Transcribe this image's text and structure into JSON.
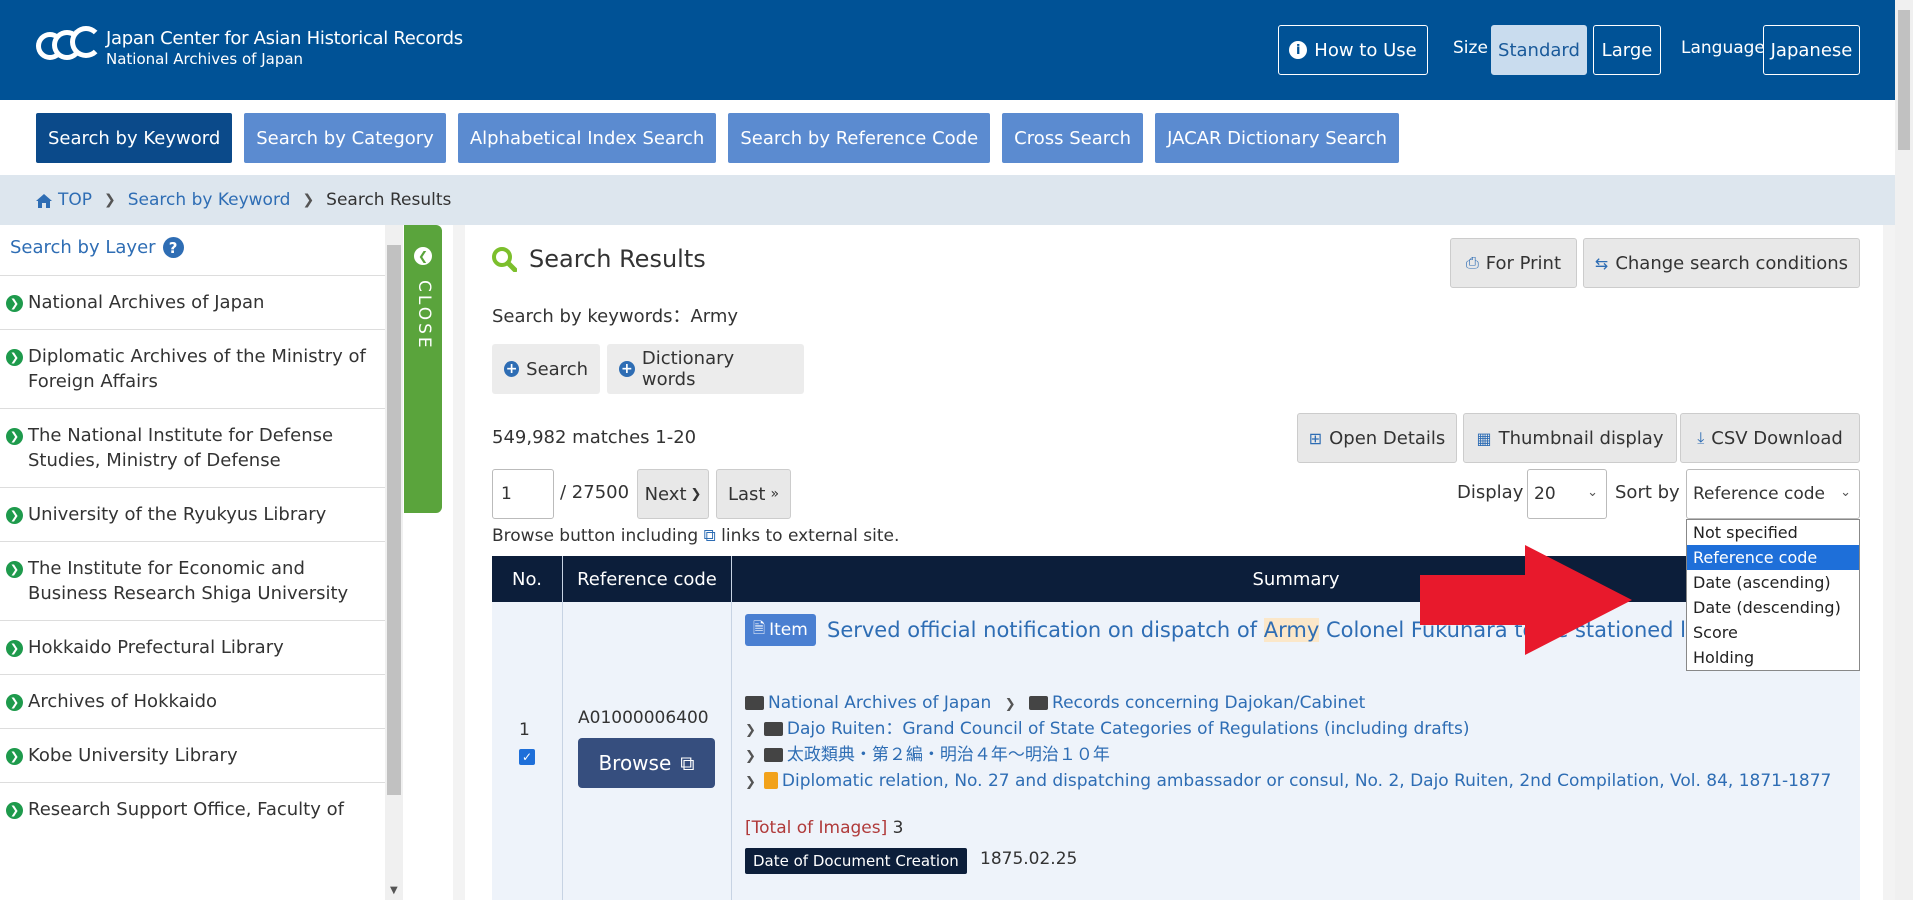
{
  "header": {
    "logo_line1": "Japan Center for Asian Historical Records",
    "logo_line2": "National Archives of Japan",
    "how_to_use": "How to Use",
    "size_label": "Size",
    "size_standard": "Standard",
    "size_large": "Large",
    "language_label": "Language",
    "language_value": "Japanese"
  },
  "tabs": [
    {
      "label": "Search by Keyword"
    },
    {
      "label": "Search by Category"
    },
    {
      "label": "Alphabetical Index Search"
    },
    {
      "label": "Search by Reference Code"
    },
    {
      "label": "Cross Search"
    },
    {
      "label": "JACAR Dictionary Search"
    }
  ],
  "breadcrumb": {
    "top": "TOP",
    "keyword": "Search by Keyword",
    "current": "Search Results"
  },
  "sidebar": {
    "title": "Search by Layer",
    "close_label": "CLOSE",
    "items": [
      {
        "label": "National Archives of Japan"
      },
      {
        "label": "Diplomatic Archives of the Ministry of Foreign Affairs"
      },
      {
        "label": "The National Institute for Defense Studies, Ministry of Defense"
      },
      {
        "label": "University of the Ryukyus Library"
      },
      {
        "label": "The Institute for Economic and Business Research Shiga University"
      },
      {
        "label": "Hokkaido Prefectural Library"
      },
      {
        "label": "Archives of Hokkaido"
      },
      {
        "label": "Kobe University Library"
      },
      {
        "label": "Research Support Office, Faculty of"
      }
    ]
  },
  "results": {
    "title": "Search Results",
    "for_print": "For Print",
    "change_conditions": "Change search conditions",
    "keywords_text": "Search by keywords：Army",
    "search_btn": "Search",
    "dictionary_btn": "Dictionary words",
    "matches": "549,982 matches 1-20",
    "open_details": "Open Details",
    "thumbnail_display": "Thumbnail display",
    "csv_download": "CSV Download",
    "page_value": "1",
    "page_total": "/ 27500",
    "next": "Next",
    "last": "Last",
    "display_label": "Display",
    "display_value": "20",
    "sort_label": "Sort by",
    "sort_value": "Reference code",
    "browse_note_a": "Browse button including",
    "browse_note_b": "links to external site.",
    "sort_options": [
      {
        "label": "Not specified"
      },
      {
        "label": "Reference code"
      },
      {
        "label": "Date (ascending)"
      },
      {
        "label": "Date (descending)"
      },
      {
        "label": "Score"
      },
      {
        "label": "Holding"
      }
    ]
  },
  "table": {
    "col_no": "No.",
    "col_ref": "Reference code",
    "col_summary": "Summary",
    "row": {
      "no": "1",
      "ref_code": "A01000006400",
      "browse": "Browse",
      "badge": "Item",
      "title_a": "Served official notification on dispatch of",
      "title_hl": "Army",
      "title_b": "Colonel Fukuhara to be stationed legation",
      "h1_a": "National Archives of Japan",
      "h1_b": "Records concerning Dajokan/Cabinet",
      "h2": "Dajo Ruiten：Grand Council of State Categories of Regulations (including drafts)",
      "h3": "太政類典・第２編・明治４年～明治１０年",
      "h4": "Diplomatic relation, No. 27 and dispatching ambassador or consul, No. 2, Dajo Ruiten, 2nd Compilation, Vol. 84, 1871-1877",
      "total_label": "[Total of Images]",
      "total_value": "3",
      "date_label": "Date of Document Creation",
      "date_value": "1875.02.25"
    }
  },
  "colors": {
    "header_bg": "#005296",
    "tab_bg": "#5b8bd0",
    "tab_active": "#0b4a8a",
    "accent_green": "#5aa43c",
    "table_header": "#0c1e3a",
    "link": "#2e6db4",
    "arrow": "#e8192c"
  }
}
